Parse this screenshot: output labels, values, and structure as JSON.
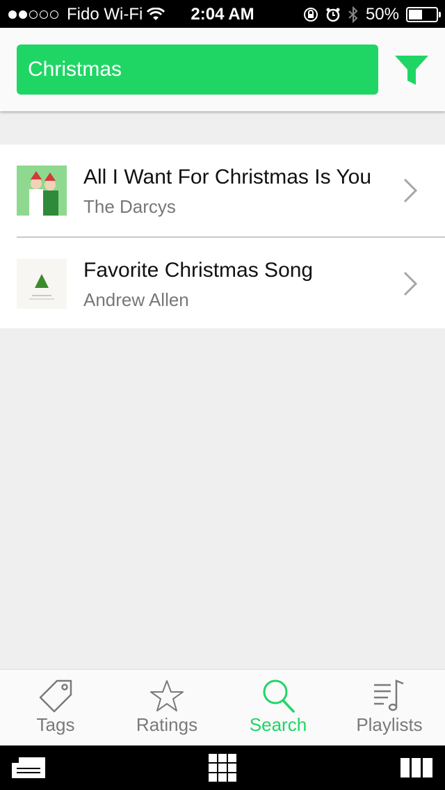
{
  "status_bar": {
    "carrier": "Fido Wi-Fi",
    "time": "2:04 AM",
    "battery": "50%",
    "battery_level": 0.5
  },
  "search": {
    "query": "Christmas",
    "filter_icon": "filter-icon"
  },
  "results": [
    {
      "title": "All I Want For Christmas Is You",
      "artist": "The Darcys"
    },
    {
      "title": "Favorite Christmas Song",
      "artist": "Andrew Allen"
    }
  ],
  "tabs": [
    {
      "label": "Tags",
      "icon": "tag-icon",
      "active": false
    },
    {
      "label": "Ratings",
      "icon": "star-icon",
      "active": false
    },
    {
      "label": "Search",
      "icon": "search-icon",
      "active": true
    },
    {
      "label": "Playlists",
      "icon": "playlist-icon",
      "active": false
    }
  ],
  "colors": {
    "accent": "#1fd665",
    "inactive": "#7a7a7a"
  }
}
